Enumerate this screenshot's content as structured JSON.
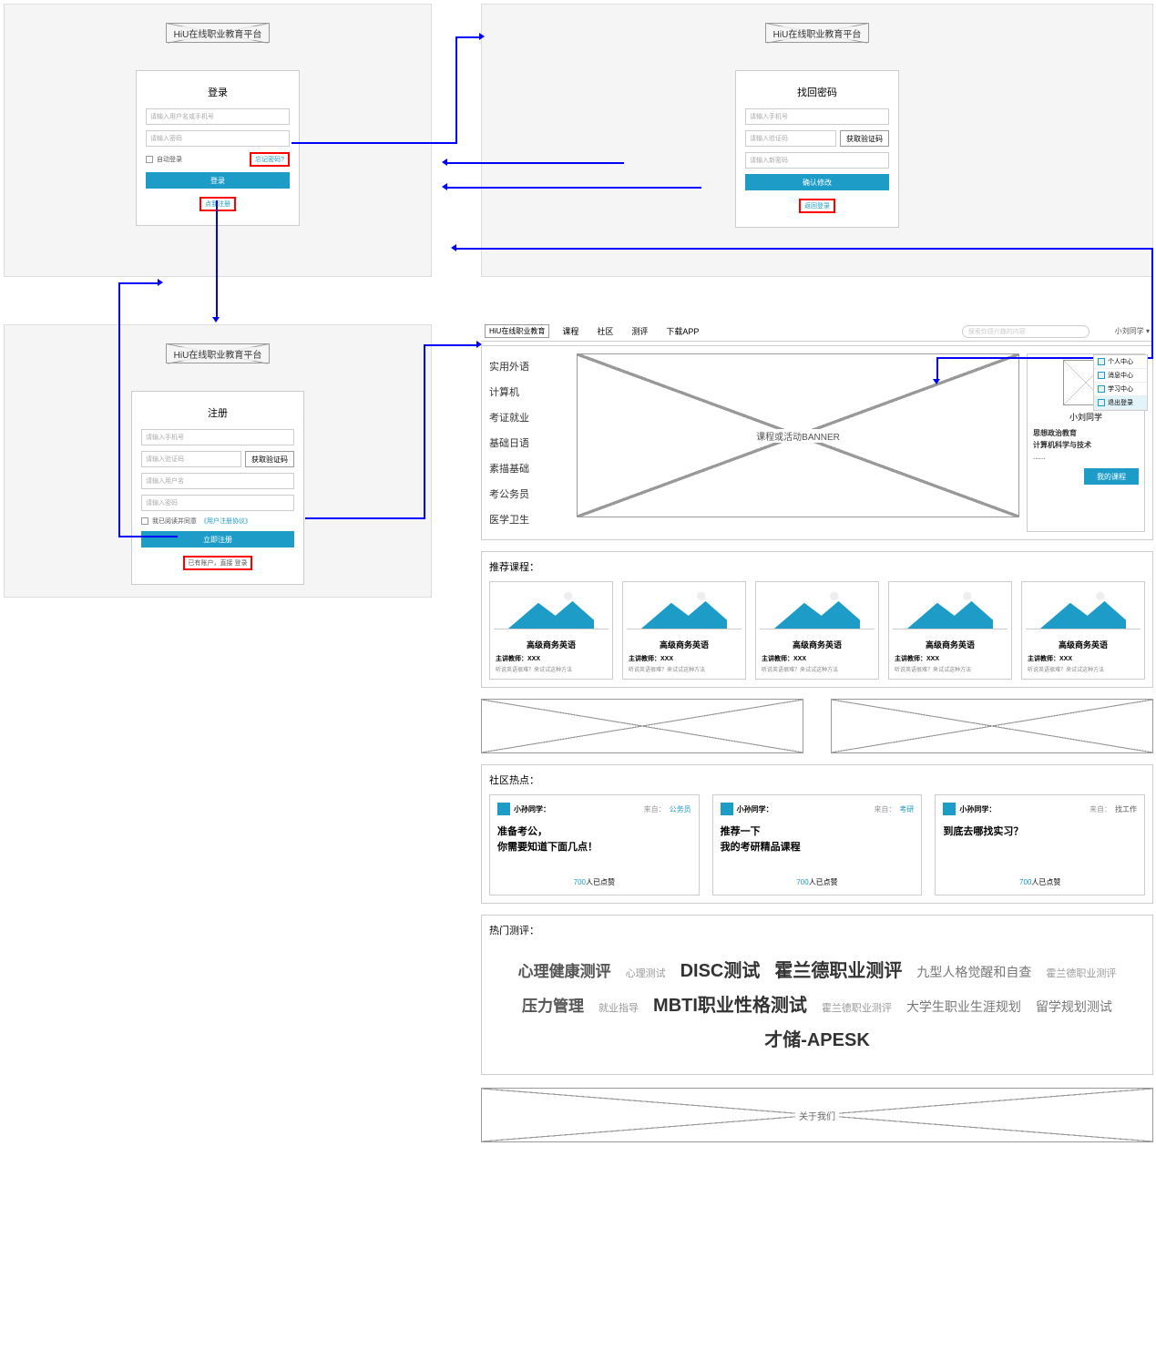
{
  "logo": "HiU在线职业教育平台",
  "login": {
    "title": "登录",
    "user_ph": "请输入用户名或手机号",
    "pass_ph": "请输入密码",
    "auto": "自动登录",
    "forgot": "忘记密码?",
    "submit": "登录",
    "register": "点我注册"
  },
  "recover": {
    "title": "找回密码",
    "phone_ph": "请输入手机号",
    "code_ph": "请输入验证码",
    "get_code": "获取验证码",
    "pass_ph": "请输入新密码",
    "submit": "确认修改",
    "back": "返回登录"
  },
  "register": {
    "title": "注册",
    "phone_ph": "请输入手机号",
    "code_ph": "请输入验证码",
    "get_code": "获取验证码",
    "user_ph": "请输入用户名",
    "pass_ph": "请输入密码",
    "agree_prefix": "我已阅读并同意",
    "agree_link": "《用户注册协议》",
    "submit": "立即注册",
    "have": "已有账户，直接 登录"
  },
  "nav": {
    "brand": "HiU在线职业教育",
    "items": [
      "课程",
      "社区",
      "测评",
      "下载APP"
    ],
    "search_ph": "搜索你感兴趣的内容",
    "user": "小刘同学 ▾"
  },
  "dropdown": [
    "个人中心",
    "消息中心",
    "学习中心",
    "退出登录"
  ],
  "categories": [
    "实用外语",
    "计算机",
    "考证就业",
    "基础日语",
    "素描基础",
    "考公务员",
    "医学卫生"
  ],
  "banner": "课程或活动BANNER",
  "profile": {
    "name": "小刘同学",
    "line1": "思想政治教育",
    "line2": "计算机科学与技术",
    "line3": "......",
    "btn": "我的课程"
  },
  "rec_title": "推荐课程：",
  "course": {
    "name": "高级商务英语",
    "teacher": "主讲教师：XXX",
    "desc": "听说英语很难？来试试这种方法"
  },
  "hot_title": "社区热点：",
  "posts": [
    {
      "name": "小孙同学：",
      "from": "来自：",
      "tag": "公务员",
      "t1": "准备考公，",
      "t2": "你需要知道下面几点！",
      "likes": "700",
      "likes_suf": "人已点赞"
    },
    {
      "name": "小孙同学：",
      "from": "来自：",
      "tag": "考研",
      "t1": "推荐一下",
      "t2": "我的考研精品课程",
      "likes": "700",
      "likes_suf": "人已点赞"
    },
    {
      "name": "小孙同学：",
      "from": "来自：",
      "tag": "找工作",
      "t1": "到底去哪找实习？",
      "t2": "",
      "likes": "700",
      "likes_suf": "人已点赞"
    }
  ],
  "test_title": "热门测评：",
  "cloud": [
    {
      "t": "心理健康测评",
      "s": "s3"
    },
    {
      "t": "心理测试",
      "s": "s1"
    },
    {
      "t": "DISC测试",
      "s": "s4"
    },
    {
      "t": "霍兰德职业测评",
      "s": "s4"
    },
    {
      "t": "九型人格觉醒和自查",
      "s": "s2"
    },
    {
      "t": "霍兰德职业测评",
      "s": "s1"
    },
    {
      "t": "压力管理",
      "s": "s3"
    },
    {
      "t": "就业指导",
      "s": "s1"
    },
    {
      "t": "MBTI职业性格测试",
      "s": "s4"
    },
    {
      "t": "霍兰德职业测评",
      "s": "s1"
    },
    {
      "t": "大学生职业生涯规划",
      "s": "s2"
    },
    {
      "t": "留学规划测试",
      "s": "s2"
    },
    {
      "t": "才储-APESK",
      "s": "s4"
    }
  ],
  "footer": "关于我们"
}
